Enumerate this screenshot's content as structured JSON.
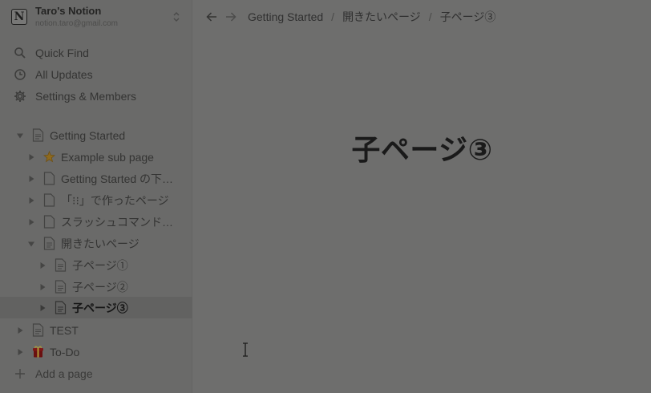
{
  "workspace": {
    "logo": "N",
    "name": "Taro's Notion",
    "email": "notion.taro@gmail.com",
    "switch_icon": "chevron-up-down-icon"
  },
  "sidebar": {
    "nav": [
      {
        "label": "Quick Find",
        "icon": "search-icon"
      },
      {
        "label": "All Updates",
        "icon": "clock-icon"
      },
      {
        "label": "Settings & Members",
        "icon": "gear-icon"
      }
    ],
    "tree": [
      {
        "label": "Getting Started",
        "icon": "page-icon",
        "expanded": true
      },
      {
        "label": "Example sub page",
        "icon": "star-icon",
        "expanded": false
      },
      {
        "label": "Getting Started の下…",
        "icon": "page-icon",
        "expanded": false
      },
      {
        "label": "「⁝⁝」で作ったページ",
        "icon": "page-icon",
        "expanded": false
      },
      {
        "label": "スラッシュコマンド…",
        "icon": "page-icon",
        "expanded": false
      },
      {
        "label": "開きたいページ",
        "icon": "page-icon",
        "expanded": true
      },
      {
        "label": "子ページ①",
        "icon": "page-icon",
        "expanded": false
      },
      {
        "label": "子ページ②",
        "icon": "page-icon",
        "expanded": false
      },
      {
        "label": "子ページ③",
        "icon": "page-icon",
        "expanded": false,
        "selected": true
      },
      {
        "label": "TEST",
        "icon": "page-icon",
        "expanded": false
      },
      {
        "label": "To-Do",
        "icon": "gift-icon",
        "expanded": false
      }
    ],
    "add_page": "Add a page"
  },
  "topbar": {
    "breadcrumb": [
      "Getting Started",
      "開きたいページ",
      "子ページ③"
    ],
    "separator": "/"
  },
  "page": {
    "title": "子ページ③"
  },
  "colors": {
    "overlay_bg": "#6e6e6d",
    "sidebar_bg": "#6a6a69",
    "selected_bg": "#626261"
  }
}
